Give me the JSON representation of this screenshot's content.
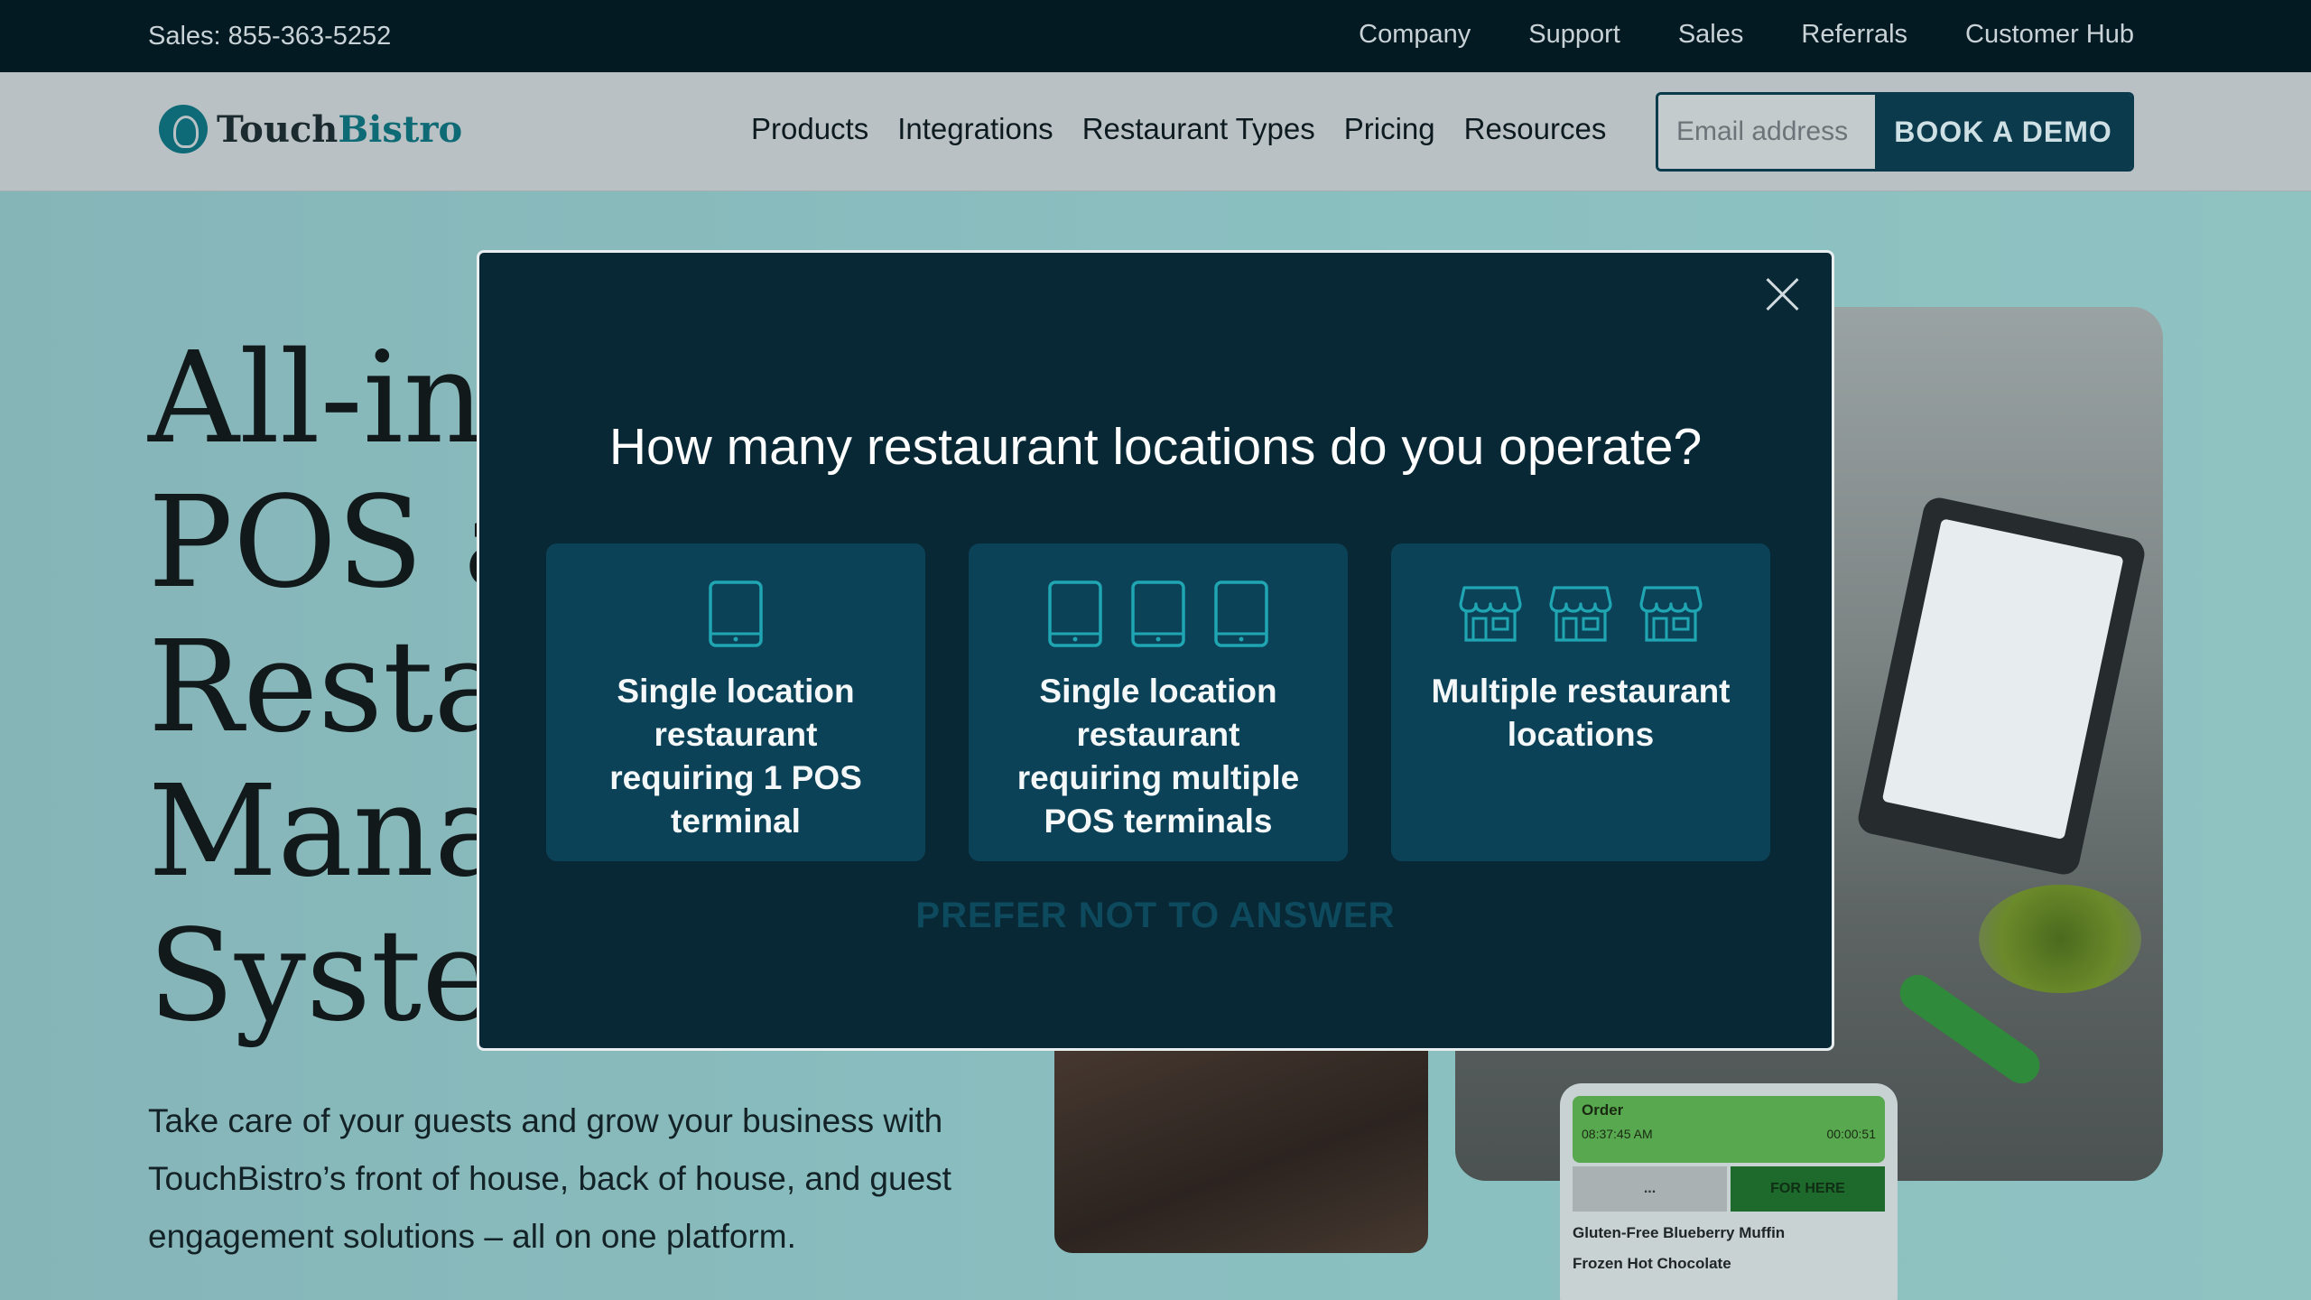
{
  "topbar": {
    "sales": "Sales: 855-363-5252",
    "links": [
      "Company",
      "Support",
      "Sales",
      "Referrals",
      "Customer Hub"
    ]
  },
  "nav": {
    "logo_touch": "Touch",
    "logo_bistro": "Bistro",
    "links": [
      "Products",
      "Integrations",
      "Restaurant Types",
      "Pricing",
      "Resources"
    ],
    "email_placeholder": "Email address",
    "demo_button": "BOOK A DEMO"
  },
  "hero": {
    "title_lines": [
      "All-in-",
      "POS an",
      "Restau",
      "Manag",
      "Syster"
    ],
    "subtitle": "Take care of your guests and grow your business with TouchBistro’s front of house, back of house, and guest engagement solutions – all on one platform."
  },
  "order_card": {
    "title": "Order",
    "time": "08:37:45 AM",
    "elapsed": "00:00:51",
    "btn_more": "...",
    "btn_for_here": "FOR HERE",
    "items": [
      "Gluten-Free Blueberry Muffin",
      "Frozen Hot Chocolate"
    ]
  },
  "modal": {
    "title": "How many restaurant locations do you operate?",
    "options": [
      {
        "label": "Single location restaurant requiring 1 POS terminal",
        "icon": "tablet-icon"
      },
      {
        "label": "Single location restaurant requiring multiple POS terminals",
        "icon": "tablet-icon"
      },
      {
        "label": "Multiple restaurant locations",
        "icon": "storefront-icon"
      }
    ],
    "prefer_not": "PREFER NOT TO ANSWER"
  },
  "colors": {
    "modal_bg": "#082835",
    "option_bg": "#0c4258",
    "icon_teal": "#1fa6b2",
    "topbar_bg": "#031a22",
    "demo_bg": "#0a3a4c"
  }
}
